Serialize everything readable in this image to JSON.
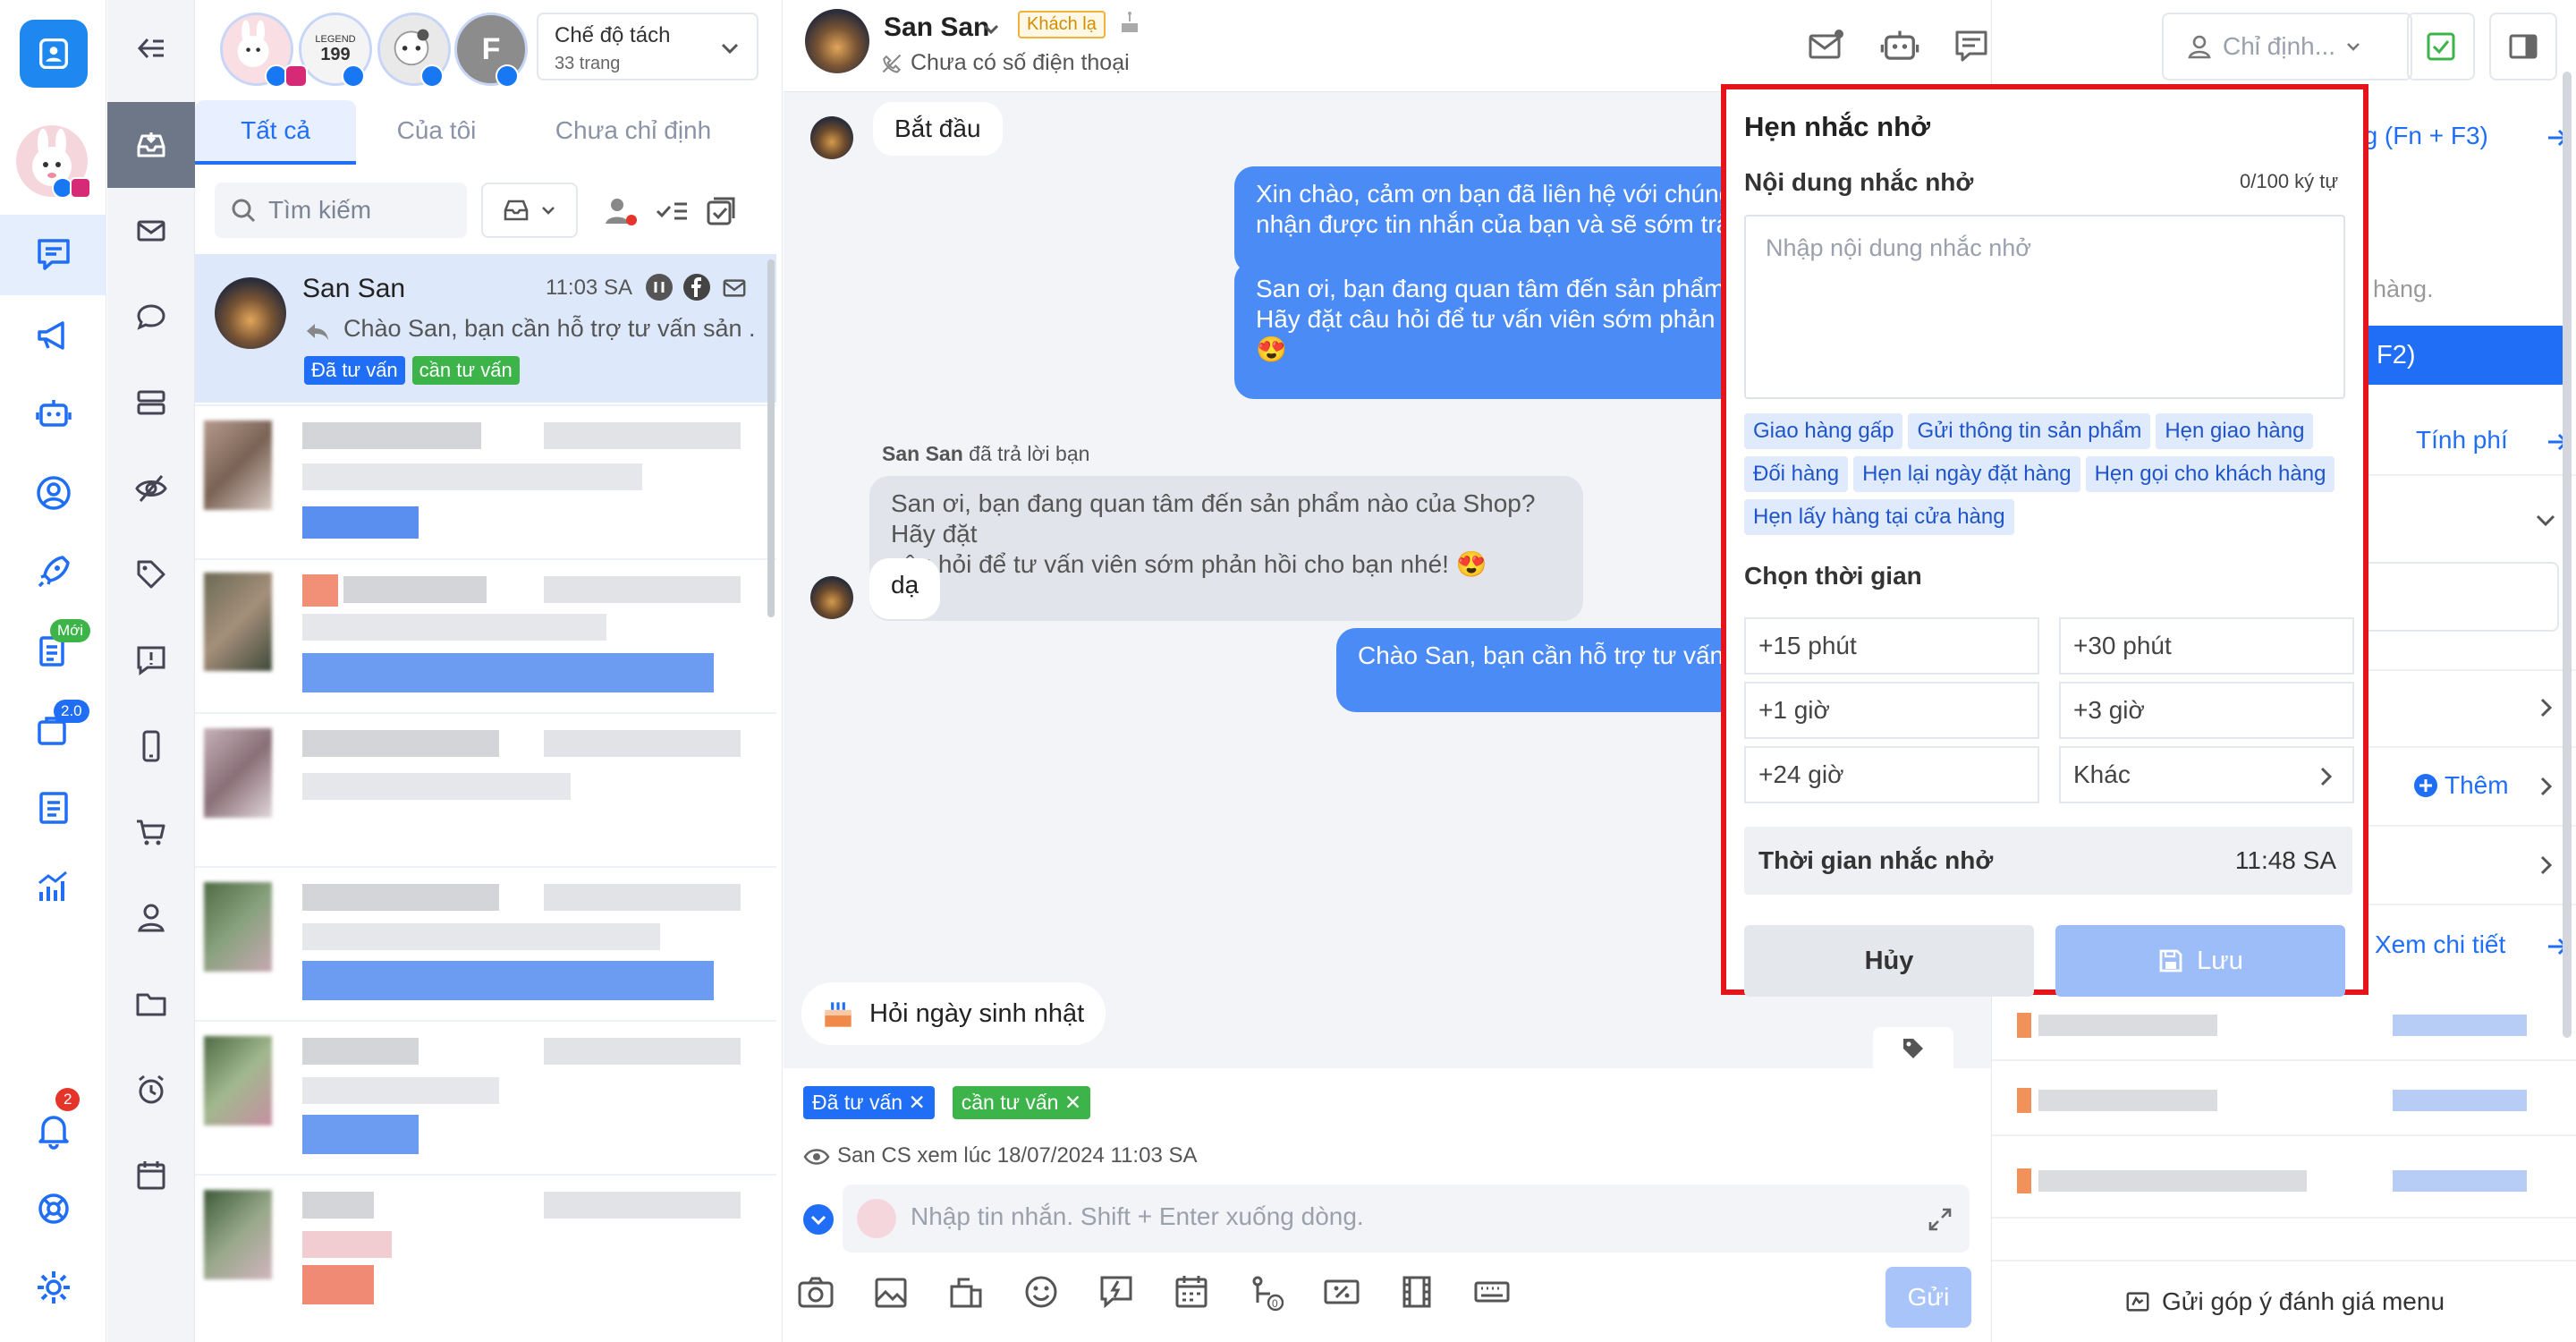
{
  "colors": {
    "accent": "#1f6ef5",
    "tag_blue": "#1f6ef5",
    "tag_green": "#3cb44a",
    "highlight": "#e5141b"
  },
  "rail": {
    "new_badge": "Mới",
    "version_badge": "2.0",
    "notif_count": "2"
  },
  "list": {
    "mode_title": "Chế độ tách",
    "mode_sub": "33 trang",
    "page_avatar_labels": [
      "LEGEND",
      "199",
      "F"
    ],
    "tabs": [
      "Tất cả",
      "Của tôi",
      "Chưa chỉ định"
    ],
    "search_placeholder": "Tìm kiếm",
    "selected": {
      "name": "San San",
      "time": "11:03 SA",
      "preview": "Chào San, bạn cần hỗ trợ tư vấn sản ...",
      "tags": [
        "Đã tư vấn",
        "cần tư vấn"
      ]
    }
  },
  "chat": {
    "name": "San San",
    "badge": "Khách lạ",
    "phone": "Chưa có số điện thoại",
    "assign": "Chỉ định...",
    "start_label": "Bắt đầu",
    "out1": [
      "Xin chào, cảm ơn bạn đã liên hệ với chúng",
      "nhận được tin nhắn của bạn và sẽ sớm trả"
    ],
    "out2": [
      "San ơi, bạn đang quan tâm đến sản phẩm",
      "Hãy đặt câu hỏi để tư vấn viên sớm phản h",
      "😍"
    ],
    "reply_meta_name": "San San",
    "reply_meta_text": "đã trả lời bạn",
    "quoted": [
      "San ơi, bạn đang quan tâm đến sản phẩm nào của Shop? Hãy đặt",
      "câu hỏi để tư vấn viên sớm phản hồi cho bạn nhé! 😍"
    ],
    "in_reply": "dạ",
    "out3": "Chào  San, bạn cần hỗ trợ tư vấn",
    "birthday": "Hỏi ngày sinh nhật",
    "tags": [
      "Đã tư vấn",
      "cần tư vấn"
    ],
    "seen": "San CS xem lúc 18/07/2024 11:03 SA",
    "input_placeholder": "Nhập tin nhắn. Shift + Enter xuống dòng.",
    "send": "Gửi"
  },
  "right": {
    "shortcut": "ng (Fn + F3)",
    "hang": "hàng.",
    "f2": "F2)",
    "tinh_phi": "Tính phí",
    "them": "Thêm",
    "xem_chi_tiet": "Xem chi tiết",
    "feedback": "Gửi góp ý đánh giá menu"
  },
  "popup": {
    "title": "Hẹn nhắc nhở",
    "content_label": "Nội dung nhắc nhở",
    "counter": "0/100 ký tự",
    "placeholder": "Nhập nội dung nhắc nhở",
    "suggestions": [
      "Giao hàng gấp",
      "Gửi thông tin sản phẩm",
      "Hẹn giao hàng",
      "Đối hàng",
      "Hẹn lại ngày đặt hàng",
      "Hẹn gọi cho khách hàng",
      "Hẹn lấy hàng tại cửa hàng"
    ],
    "time_label": "Chọn thời gian",
    "times": [
      "+15 phút",
      "+30 phút",
      "+1 giờ",
      "+3 giờ",
      "+24 giờ",
      "Khác"
    ],
    "remind_label": "Thời gian nhắc nhở",
    "remind_value": "11:48 SA",
    "cancel": "Hủy",
    "save": "Lưu"
  }
}
